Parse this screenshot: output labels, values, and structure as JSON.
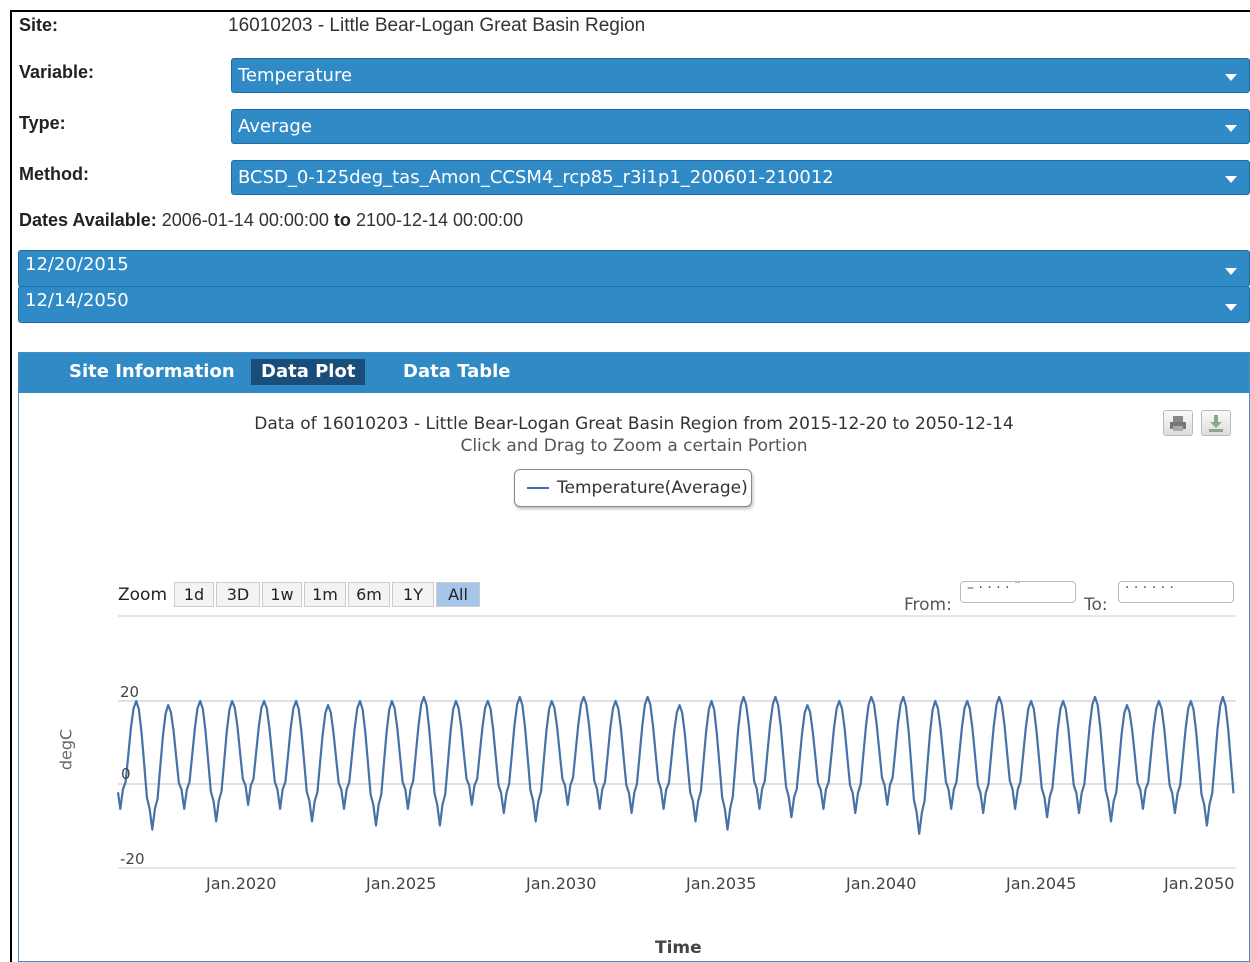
{
  "form": {
    "site_label": "Site:",
    "site_value": "16010203 - Little Bear-Logan Great Basin Region",
    "variable_label": "Variable:",
    "variable_value": "Temperature",
    "type_label": "Type:",
    "type_value": "Average",
    "method_label": "Method:",
    "method_value": "BCSD_0-125deg_tas_Amon_CCSM4_rcp85_r3i1p1_200601-210012",
    "dates_label": "Dates Available:",
    "dates_from": "2006-01-14 00:00:00",
    "dates_to_word": "to",
    "dates_to": "2100-12-14 00:00:00",
    "start_date": "12/20/2015",
    "end_date": "12/14/2050"
  },
  "tabs": [
    {
      "label": "Site Information"
    },
    {
      "label": "Data Plot"
    },
    {
      "label": "Data Table"
    }
  ],
  "chart": {
    "title": "Data of 16010203 - Little Bear-Logan Great Basin Region from 2015-12-20 to 2050-12-14",
    "subtitle": "Click and Drag to Zoom a certain Portion",
    "legend": "Temperature(Average)",
    "zoom_label": "Zoom",
    "zoom_buttons": [
      "1d",
      "3D",
      "1w",
      "1m",
      "6m",
      "1Y",
      "All"
    ],
    "zoom_active": "All",
    "from_label": "From:",
    "to_label": "To:",
    "line_color": "#4572a7",
    "accent": "#2f8ac6"
  },
  "chart_data": {
    "type": "line",
    "xlabel": "Time",
    "ylabel": "degC",
    "x_ticks": [
      "Jan.2020",
      "Jan.2025",
      "Jan.2030",
      "Jan.2035",
      "Jan.2040",
      "Jan.2045",
      "Jan.2050"
    ],
    "y_ticks": [
      "20",
      "0",
      "-20"
    ],
    "ylim": [
      -20,
      20
    ],
    "xlim": [
      "2015-12-20",
      "2050-12-14"
    ],
    "series": [
      {
        "name": "Temperature(Average)",
        "description": "monthly average temperature, seasonal cycle",
        "annual_peaks_degC": [
          20,
          19,
          20,
          20,
          20,
          20,
          19,
          20,
          20,
          21,
          20,
          20,
          21,
          20,
          21,
          20,
          21,
          19,
          20,
          21,
          21,
          19,
          20,
          21,
          21,
          20,
          20,
          21,
          20,
          20,
          21,
          19,
          20,
          20,
          21
        ],
        "annual_troughs_degC": [
          -6,
          -11,
          -6,
          -9,
          -5,
          -6,
          -9,
          -6,
          -10,
          -6,
          -10,
          -5,
          -7,
          -9,
          -5,
          -6,
          -7,
          -6,
          -9,
          -11,
          -6,
          -8,
          -6,
          -7,
          -5,
          -12,
          -6,
          -7,
          -6,
          -8,
          -7,
          -9,
          -6,
          -7,
          -10
        ]
      }
    ]
  }
}
